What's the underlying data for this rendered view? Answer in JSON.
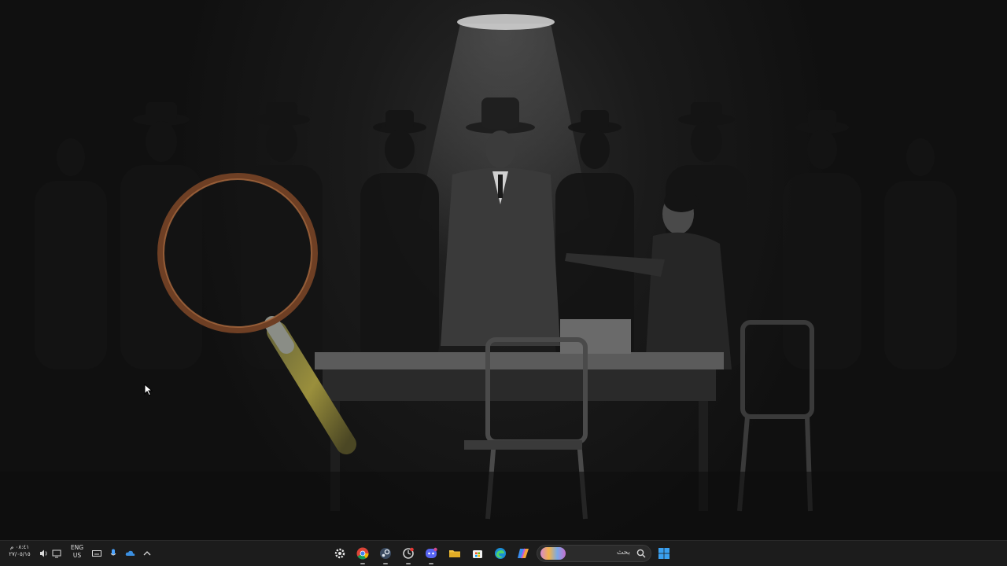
{
  "desktop": {
    "wallpaper": "noir-interrogation-room",
    "overlay": "magnifying-glass-icon"
  },
  "taskbar": {
    "clock": {
      "time": "٠٨:٤١ م",
      "date": "٢٧/٠٥/١٥"
    },
    "language": {
      "line1": "ENG",
      "line2": "US"
    },
    "tray_icons": [
      "volume-icon",
      "display-icon",
      "keyboard-icon",
      "microphone-icon",
      "onedrive-icon",
      "chevron-up-icon"
    ],
    "apps": [
      "settings-gear-icon",
      "chrome-icon",
      "steam-icon",
      "shutdown-timer-icon",
      "discord-icon",
      "file-explorer-icon",
      "microsoft-store-icon",
      "edge-icon",
      "copilot-icon"
    ],
    "search": {
      "label": "بحث"
    },
    "start_icon": "windows-start-icon",
    "colors": {
      "taskbar_bg": "#1c1c1c",
      "windows_blue": "#3aa0f0"
    }
  }
}
